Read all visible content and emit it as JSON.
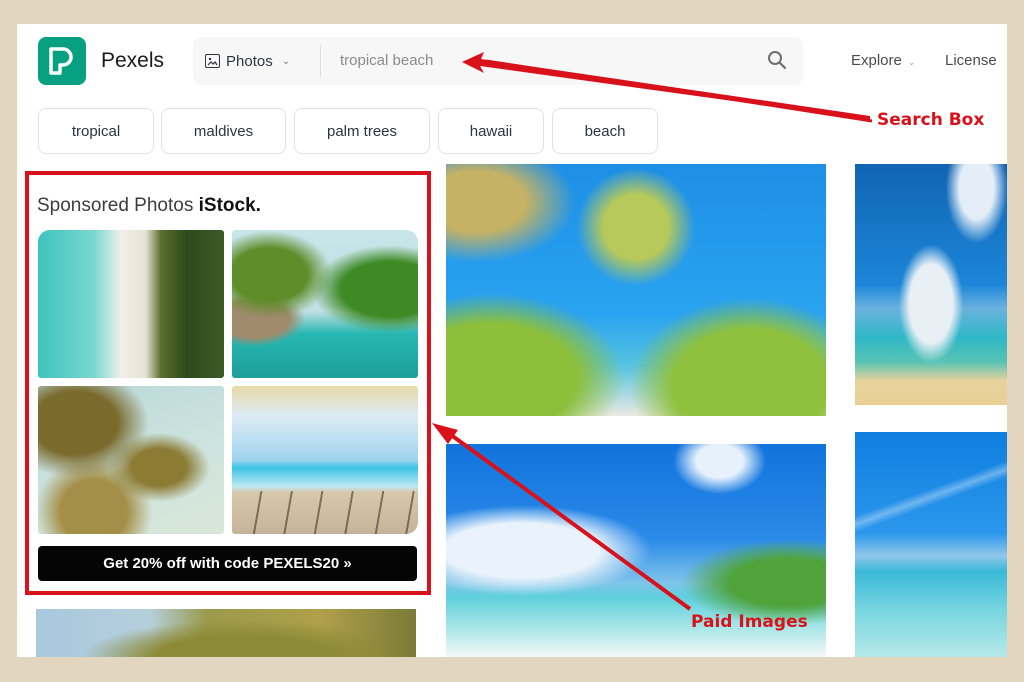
{
  "header": {
    "brand": "Pexels",
    "logo_icon": "pexels-p-logo",
    "search": {
      "type_label": "Photos",
      "type_icon": "image-icon",
      "query": "tropical beach",
      "search_icon": "magnifier-icon"
    },
    "nav": [
      {
        "label": "Explore",
        "has_dropdown": true
      },
      {
        "label": "License",
        "has_dropdown": false
      }
    ]
  },
  "chips": [
    "tropical",
    "maldives",
    "palm trees",
    "hawaii",
    "beach"
  ],
  "sponsored": {
    "title": "Sponsored Photos",
    "partner": "iStock.",
    "images": [
      "Aerial beach with palm trees",
      "Palm leaves over tropical lagoon",
      "Palm trees against sky",
      "Wooden deck facing sparkling sea"
    ],
    "cta": "Get 20% off with code PEXELS20 »"
  },
  "gallery": [
    "Palm trees over jetty",
    "Tropical island beach with clouds",
    "Blue sky over beach",
    "Shallow turquoise water",
    "Palm tree against sky"
  ],
  "annotations": {
    "search_box": "Search Box",
    "paid_images": "Paid Images",
    "color": "#d8111a"
  },
  "colors": {
    "brand": "#07a081",
    "frame": "#e2d6c1",
    "cta": "#050505"
  }
}
